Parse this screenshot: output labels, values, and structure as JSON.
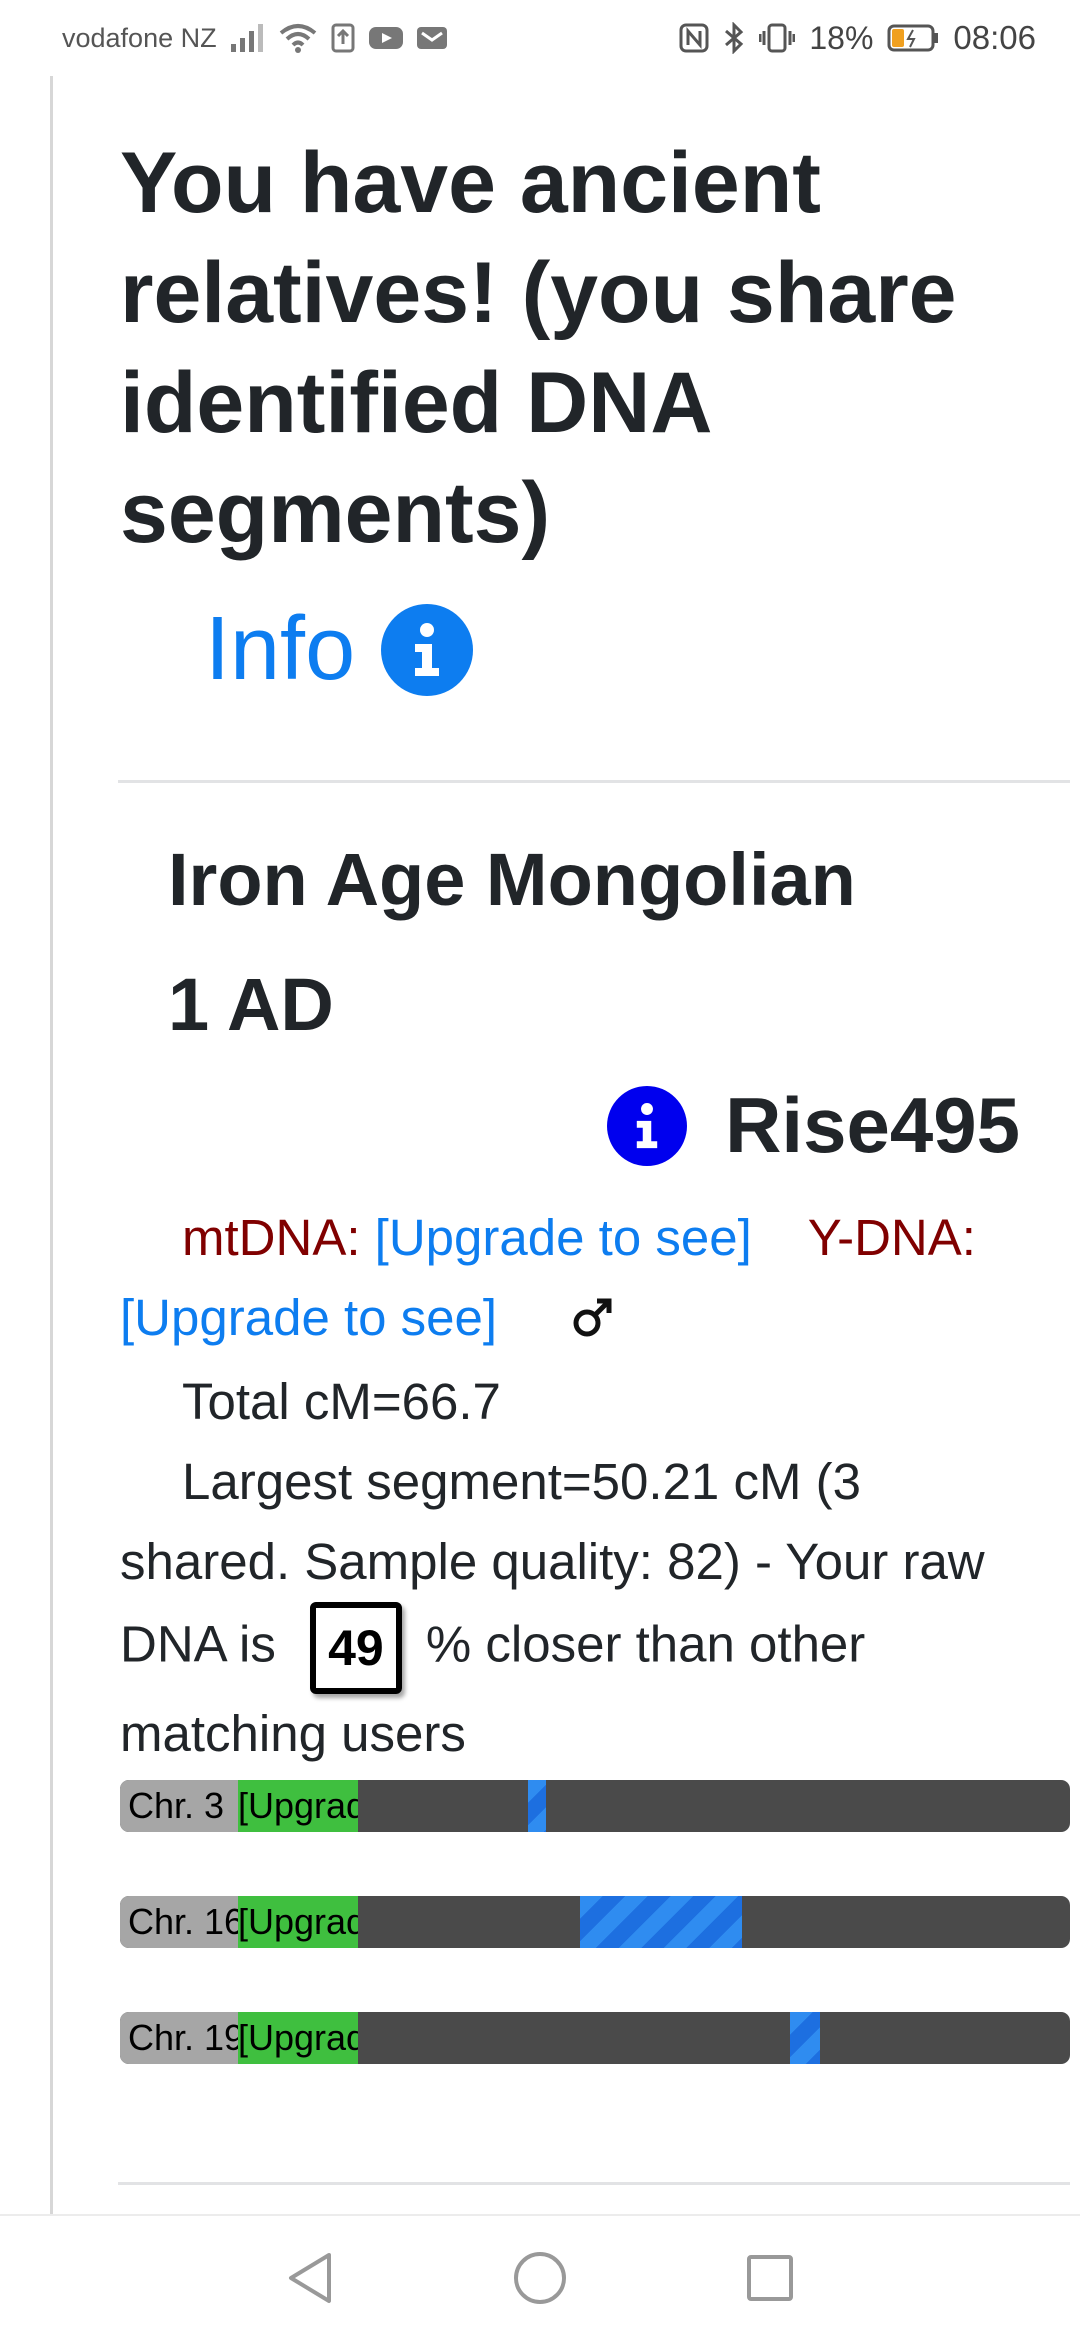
{
  "status_bar": {
    "carrier": "vodafone NZ",
    "battery_percent": "18%",
    "time": "08:06"
  },
  "page": {
    "title": "You have ancient relatives! (you share identified DNA segments)",
    "info_label": "Info"
  },
  "match": {
    "title": "Iron Age Mongolian",
    "date": "1 AD",
    "username": "Rise495",
    "mtdna_label": "mtDNA:",
    "mtdna_value": "[Upgrade to see]",
    "ydna_label": "Y-DNA:",
    "ydna_value": "[Upgrade to see]",
    "total_cm": "Total cM=66.7",
    "largest_segment_text": "Largest segment=50.21 cM (3 shared. Sample quality: 82) - Your raw DNA is",
    "closer_percent": "49",
    "closer_suffix": "% closer than other matching users",
    "chromosomes": [
      {
        "label": "Chr. 3",
        "upgrade_text": "[Upgrade to see]"
      },
      {
        "label": "Chr. 16",
        "upgrade_text": "[Upgrade to see]"
      },
      {
        "label": "Chr. 19",
        "upgrade_text": "[Upgrade to see]"
      }
    ]
  },
  "colors": {
    "link_blue": "#0d7df0",
    "dna_label_red": "#800000",
    "chr_bar_dark": "#4a4a4a",
    "chr_upgrade_green": "#3fbf3f",
    "segment_blue": "#2f8cf0"
  }
}
